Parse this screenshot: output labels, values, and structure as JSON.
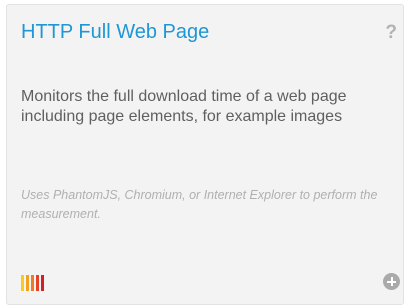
{
  "card": {
    "title": "HTTP Full Web Page",
    "help_icon": "?",
    "description": "Monitors the full download time of a web page including page elements, for example images",
    "note": "Uses PhantomJS, Chromium, or Internet Explorer to perform the measurement.",
    "performance_impact": {
      "icon": "signal-bars-icon",
      "bar_colors": [
        "#f5cd1a",
        "#f1a21f",
        "#ec7a26",
        "#e5422a",
        "#d41e26"
      ]
    },
    "add_icon": "plus-circle-icon"
  }
}
